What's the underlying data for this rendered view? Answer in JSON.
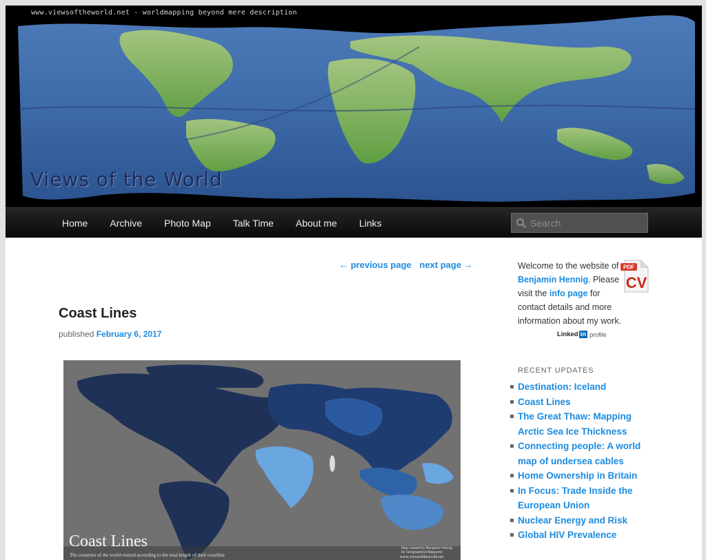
{
  "header": {
    "tagline": "www.viewsoftheworld.net - worldmapping beyond mere description",
    "site_title": "Views of the World"
  },
  "nav": {
    "items": [
      "Home",
      "Archive",
      "Photo Map",
      "Talk Time",
      "About me",
      "Links"
    ],
    "search_placeholder": "Search"
  },
  "pager": {
    "previous": "← previous page",
    "next": "next page →"
  },
  "post": {
    "title": "Coast Lines",
    "meta_prefix": "published",
    "date": "February 6, 2017",
    "image": {
      "title": "Coast Lines",
      "subtitle": "The countries of the world resized according to the total length of their coastline",
      "credit": "Map created by Benjamin Hennig for Geographical Magazine",
      "url": "www.viewsoftheworld.net"
    }
  },
  "sidebar": {
    "welcome_1": "Welcome to the website of",
    "author_link": "Benjamin Hennig",
    "welcome_2": ". Please visit the",
    "info_link": "info page",
    "welcome_3": "for contact details and more information about my work.",
    "cv_label": "CV",
    "cv_badge": "PDF",
    "linkedin_word": "Linked",
    "linkedin_in": "in",
    "linkedin_profile": "profile",
    "recent_heading": "RECENT UPDATES",
    "recent": [
      "Destination: Iceland",
      "Coast Lines",
      "The Great Thaw: Mapping Arctic Sea Ice Thickness",
      "Connecting people: A world map of undersea cables",
      "Home Ownership in Britain",
      "In Focus: Trade Inside the European Union",
      "Nuclear Energy and Risk",
      "Global HIV Prevalence"
    ]
  },
  "colors": {
    "link": "#1b8be0",
    "nav_bg": "#1a1a1a",
    "page_bg": "#e2e2e2"
  }
}
